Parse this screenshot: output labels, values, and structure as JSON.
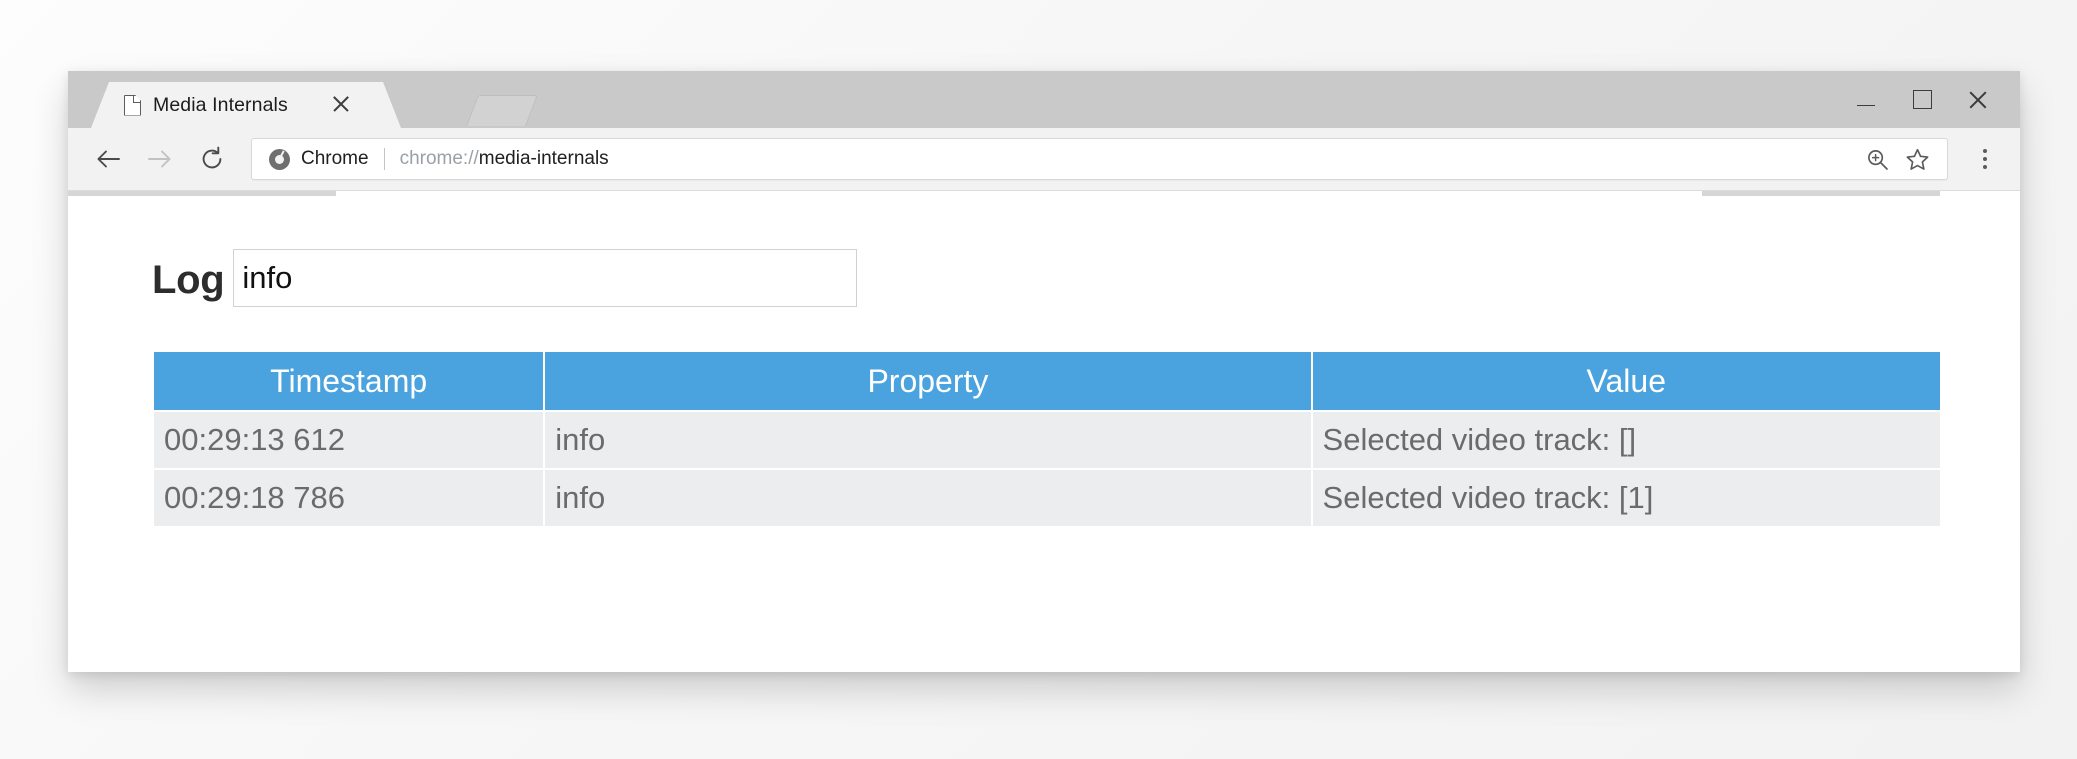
{
  "window": {
    "controls": {
      "minimize_label": "Minimize",
      "maximize_label": "Maximize",
      "close_label": "Close"
    }
  },
  "tab_strip": {
    "tabs": [
      {
        "title": "Media Internals",
        "favicon": "page-icon",
        "close_label": "Close tab",
        "active": true
      }
    ],
    "new_tab_label": "New tab"
  },
  "toolbar": {
    "back_label": "Back",
    "forward_label": "Forward",
    "reload_label": "Reload",
    "omnibox": {
      "brand_icon": "chrome-logo-icon",
      "security_label": "Chrome",
      "url_scheme": "chrome://",
      "url_path": "media-internals",
      "full_url": "chrome://media-internals"
    },
    "zoom_label": "Zoom",
    "bookmark_label": "Bookmark this page",
    "menu_label": "Customize and control Chrome"
  },
  "page": {
    "heading": "Log",
    "filter_input": {
      "value": "info",
      "placeholder": ""
    },
    "table": {
      "columns": [
        "Timestamp",
        "Property",
        "Value"
      ],
      "rows": [
        {
          "timestamp": "00:29:13 612",
          "property": "info",
          "value": "Selected video track: []"
        },
        {
          "timestamp": "00:29:18 786",
          "property": "info",
          "value": "Selected video track: [1]"
        }
      ]
    }
  },
  "colors": {
    "table_header_blue": "#4aa3df",
    "table_row_gray": "#ecedee",
    "table_row_text": "#6b6b6b",
    "tab_strip": "#c9c9c9",
    "toolbar": "#f2f2f2"
  }
}
